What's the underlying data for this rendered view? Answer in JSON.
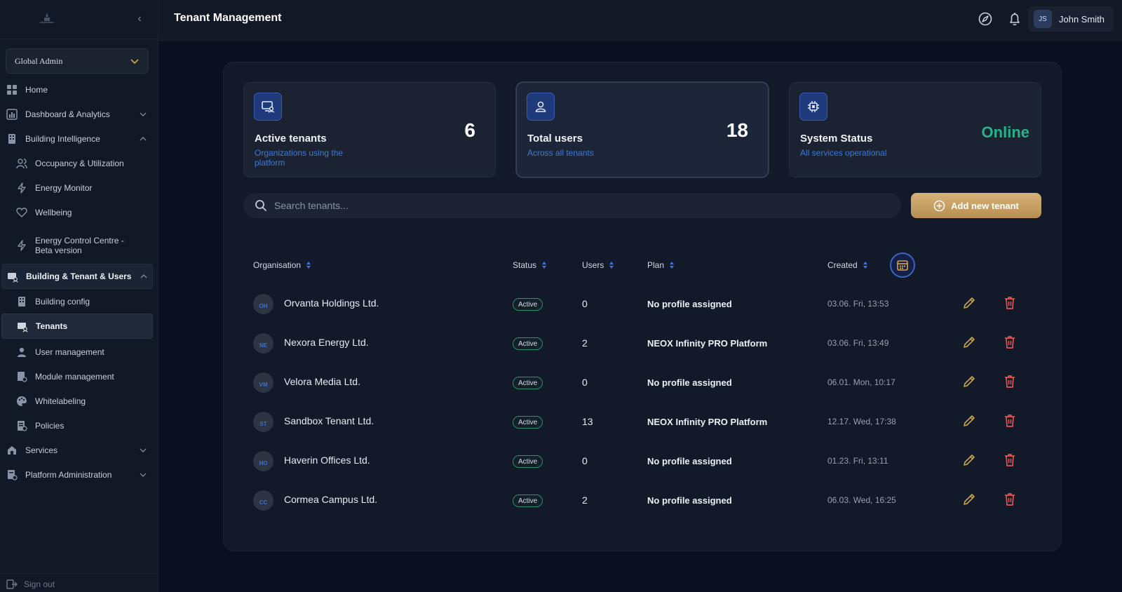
{
  "colors": {
    "background": "#0b1020",
    "sidebar": "#111826",
    "accent_blue": "#3d78d8",
    "online_green": "#25b28a",
    "gold": "#c9a064",
    "danger": "#e25454"
  },
  "sidebar": {
    "role_select": {
      "value": "Global Admin",
      "icon": "chevron-down-icon"
    },
    "items": [
      {
        "label": "Home",
        "icon": "grid-icon"
      },
      {
        "label": "Dashboard & Analytics",
        "icon": "chart-icon",
        "chevron": "chevron-down-icon"
      },
      {
        "label": "Building Intelligence",
        "icon": "building-icon",
        "chevron": "chevron-up-icon"
      },
      {
        "label": "Occupancy & Utilization",
        "icon": "users-icon"
      },
      {
        "label": "Energy Monitor",
        "icon": "lightning-icon"
      },
      {
        "label": "Wellbeing",
        "icon": "heart-icon"
      },
      {
        "label": "Energy Control Centre -",
        "label2": "Beta version",
        "icon": "lightning-icon"
      },
      {
        "label": "Building & Tenant & Users",
        "icon": "monitor-users-icon",
        "chevron": "chevron-up-icon"
      },
      {
        "label": "Building config",
        "icon": "building-icon"
      },
      {
        "label": "Tenants",
        "icon": "monitor-users-icon"
      },
      {
        "label": "User management",
        "icon": "user-icon"
      },
      {
        "label": "Module management",
        "icon": "module-icon"
      },
      {
        "label": "Whitelabeling",
        "icon": "palette-icon"
      },
      {
        "label": "Policies",
        "icon": "document-icon"
      },
      {
        "label": "Services",
        "icon": "services-icon",
        "chevron": "chevron-down-icon"
      },
      {
        "label": "Platform Administration",
        "icon": "admin-icon",
        "chevron": "chevron-down-icon"
      }
    ],
    "footer": {
      "label": "Sign out",
      "icon": "sign-out-icon"
    }
  },
  "topbar": {
    "title": "Tenant Management",
    "icons": [
      "compass-icon",
      "bell-icon"
    ],
    "user": {
      "initials": "JS",
      "name": "John Smith"
    }
  },
  "stats": [
    {
      "title": "Active tenants",
      "subtitle": "Organizations using the platform",
      "value": "6",
      "icon": "monitor-users-icon"
    },
    {
      "title": "Total users",
      "subtitle": "Across all tenants",
      "value": "18",
      "icon": "user-icon"
    },
    {
      "title": "System Status",
      "subtitle": "All services operational",
      "value": "Online",
      "icon": "chip-icon"
    }
  ],
  "search": {
    "placeholder": "Search tenants..."
  },
  "add_button": {
    "label": "Add new tenant",
    "icon": "plus-circle-icon"
  },
  "table": {
    "columns": [
      "Organisation",
      "Status",
      "Users",
      "Plan",
      "Created"
    ],
    "rows": [
      {
        "initials": "OH",
        "organisation": "Orvanta Holdings Ltd.",
        "status": "Active",
        "users": "0",
        "plan": "No profile assigned",
        "created": "03.06. Fri, 13:53"
      },
      {
        "initials": "NE",
        "organisation": "Nexora Energy Ltd.",
        "status": "Active",
        "users": "2",
        "plan": "NEOX Infinity PRO Platform",
        "created": "03.06. Fri, 13:49"
      },
      {
        "initials": "VM",
        "organisation": "Velora Media Ltd.",
        "status": "Active",
        "users": "0",
        "plan": "No profile assigned",
        "created": "06.01. Mon, 10:17"
      },
      {
        "initials": "ST",
        "organisation": "Sandbox Tenant Ltd.",
        "status": "Active",
        "users": "13",
        "plan": "NEOX Infinity PRO Platform",
        "created": "12.17. Wed, 17:38"
      },
      {
        "initials": "HO",
        "organisation": "Haverin Offices Ltd.",
        "status": "Active",
        "users": "0",
        "plan": "No profile assigned",
        "created": "01.23. Fri, 13:11"
      },
      {
        "initials": "CC",
        "organisation": "Cormea Campus Ltd.",
        "status": "Active",
        "users": "2",
        "plan": "No profile assigned",
        "created": "06.03. Wed, 16:25"
      }
    ]
  }
}
